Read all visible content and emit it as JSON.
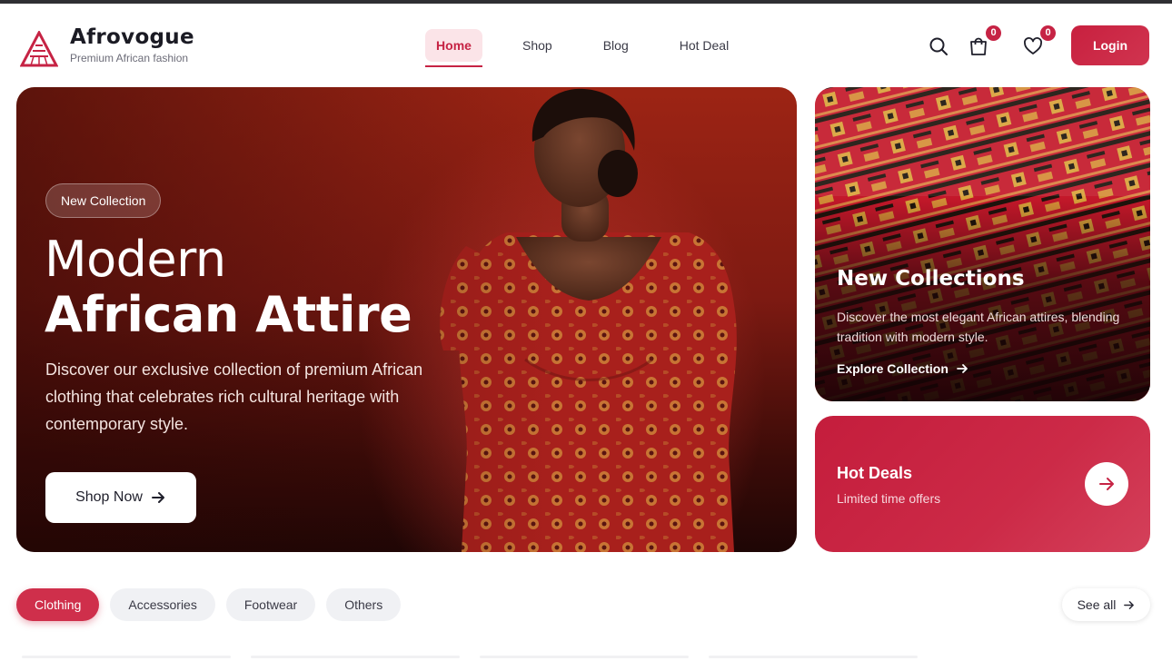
{
  "brand": {
    "name": "Afrovogue",
    "tagline": "Premium African fashion"
  },
  "nav": {
    "items": [
      "Home",
      "Shop",
      "Blog",
      "Hot Deal"
    ],
    "active": "Home"
  },
  "header": {
    "cart_count": "0",
    "wishlist_count": "0",
    "login_label": "Login"
  },
  "hero": {
    "badge": "New Collection",
    "title_line1": "Modern",
    "title_line2": "African Attire",
    "description": "Discover our exclusive collection of premium African clothing that celebrates rich cultural heritage with contemporary style.",
    "cta_label": "Shop Now"
  },
  "new_collections": {
    "title": "New Collections",
    "description": "Discover the most elegant African attires, blending tradition with modern style.",
    "link_label": "Explore Collection"
  },
  "hot_deals": {
    "title": "Hot Deals",
    "subtitle": "Limited time offers"
  },
  "categories": {
    "items": [
      "Clothing",
      "Accessories",
      "Footwear",
      "Others"
    ],
    "active": "Clothing",
    "see_all_label": "See all"
  },
  "colors": {
    "accent": "#c62344",
    "accent_light": "#fbe4e8",
    "hero_bg": "#7e1a12"
  }
}
